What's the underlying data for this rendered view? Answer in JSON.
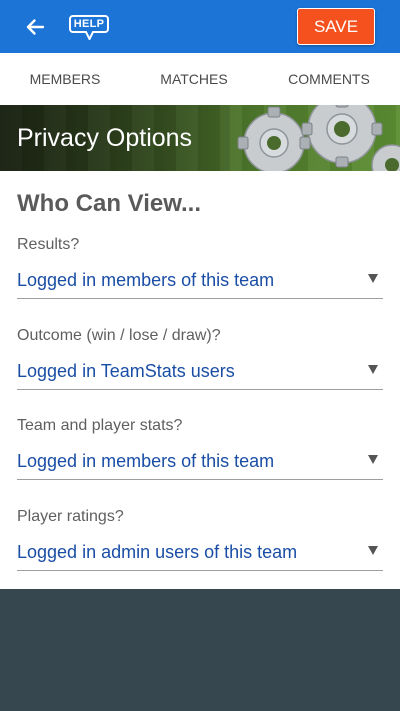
{
  "topbar": {
    "help_label": "HELP",
    "save_label": "SAVE"
  },
  "tabs": [
    {
      "label": "MEMBERS"
    },
    {
      "label": "MATCHES",
      "active": true
    },
    {
      "label": "COMMENTS"
    }
  ],
  "banner": {
    "title": "Privacy Options"
  },
  "card": {
    "heading": "Who Can View...",
    "fields": [
      {
        "label": "Results?",
        "value": "Logged in members of this team"
      },
      {
        "label": "Outcome (win / lose / draw)?",
        "value": "Logged in TeamStats users"
      },
      {
        "label": "Team and player stats?",
        "value": "Logged in members of this team"
      },
      {
        "label": "Player ratings?",
        "value": "Logged in admin users of this team"
      }
    ]
  },
  "icons": {
    "back": "back-arrow-icon",
    "help": "help-speech-bubble-icon",
    "dropdown": "dropdown-triangle-icon",
    "banner_art": "gears-icon"
  },
  "colors": {
    "topbar": "#1b74d6",
    "save_button": "#f4511e",
    "tab_indicator": "#f4a021",
    "select_text": "#1a4ea6",
    "page_background": "#37474f"
  }
}
